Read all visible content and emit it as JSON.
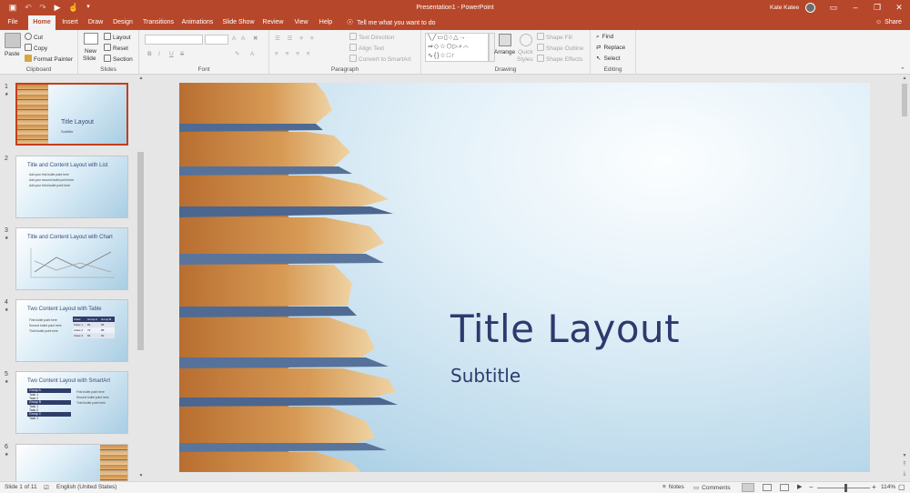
{
  "titlebar": {
    "doc_title": "Presentation1 - PowerPoint",
    "user_name": "Kate Katee"
  },
  "tabs": [
    {
      "label": "File"
    },
    {
      "label": "Home"
    },
    {
      "label": "Insert"
    },
    {
      "label": "Draw"
    },
    {
      "label": "Design"
    },
    {
      "label": "Transitions"
    },
    {
      "label": "Animations"
    },
    {
      "label": "Slide Show"
    },
    {
      "label": "Review"
    },
    {
      "label": "View"
    },
    {
      "label": "Help"
    }
  ],
  "tell_me": "Tell me what you want to do",
  "share_label": "Share",
  "ribbon": {
    "clipboard": {
      "label": "Clipboard",
      "paste": "Paste",
      "cut": "Cut",
      "copy": "Copy",
      "format_painter": "Format Painter"
    },
    "slides": {
      "label": "Slides",
      "new_slide": "New",
      "new_slide2": "Slide",
      "layout": "Layout",
      "reset": "Reset",
      "section": "Section"
    },
    "font": {
      "label": "Font",
      "bold": "B",
      "italic": "I",
      "underline": "U",
      "strike": "S",
      "aa": "A"
    },
    "paragraph": {
      "label": "Paragraph",
      "text_direction": "Text Direction",
      "align_text": "Align Text",
      "convert": "Convert to SmartArt"
    },
    "drawing": {
      "label": "Drawing",
      "arrange": "Arrange",
      "quick_styles": "Quick",
      "quick_styles2": "Styles",
      "shape_fill": "Shape Fill",
      "shape_outline": "Shape Outline",
      "shape_effects": "Shape Effects"
    },
    "editing": {
      "label": "Editing",
      "find": "Find",
      "replace": "Replace",
      "select": "Select"
    }
  },
  "thumbnails": [
    {
      "num": "1",
      "title": "Title Layout",
      "subtitle": "Subtitle"
    },
    {
      "num": "2",
      "title": "Title and Content Layout with List",
      "bullets": [
        "Add your first bullet point here",
        "Add your second bullet point here",
        "Add your third bullet point here"
      ]
    },
    {
      "num": "3",
      "title": "Title and Content Layout with Chart"
    },
    {
      "num": "4",
      "title": "Two Content Layout with Table",
      "bullets": [
        "First bullet point here",
        "Second bullet point here",
        "Third bullet point here"
      ],
      "table_header": [
        "Class",
        "Group A",
        "Group B"
      ],
      "table_rows": [
        [
          "Class 1",
          "82",
          "95"
        ],
        [
          "Class 2",
          "76",
          "88"
        ],
        [
          "Class 3",
          "84",
          "90"
        ]
      ]
    },
    {
      "num": "5",
      "title": "Two Content Layout with SmartArt",
      "groups": [
        "Group A",
        "Group B",
        "Group C"
      ],
      "items": [
        "Task 1",
        "Task 2"
      ],
      "bullets": [
        "First bullet point here",
        "Second bullet point here",
        "Third bullet point here"
      ]
    },
    {
      "num": "6"
    }
  ],
  "slide": {
    "title": "Title Layout",
    "subtitle": "Subtitle",
    "title_color": "#2e3a6e"
  },
  "status": {
    "slide_count": "Slide 1 of 11",
    "language": "English (United States)",
    "notes": "Notes",
    "comments": "Comments",
    "zoom": "114%"
  },
  "colors": {
    "accent": "#b7472a"
  }
}
